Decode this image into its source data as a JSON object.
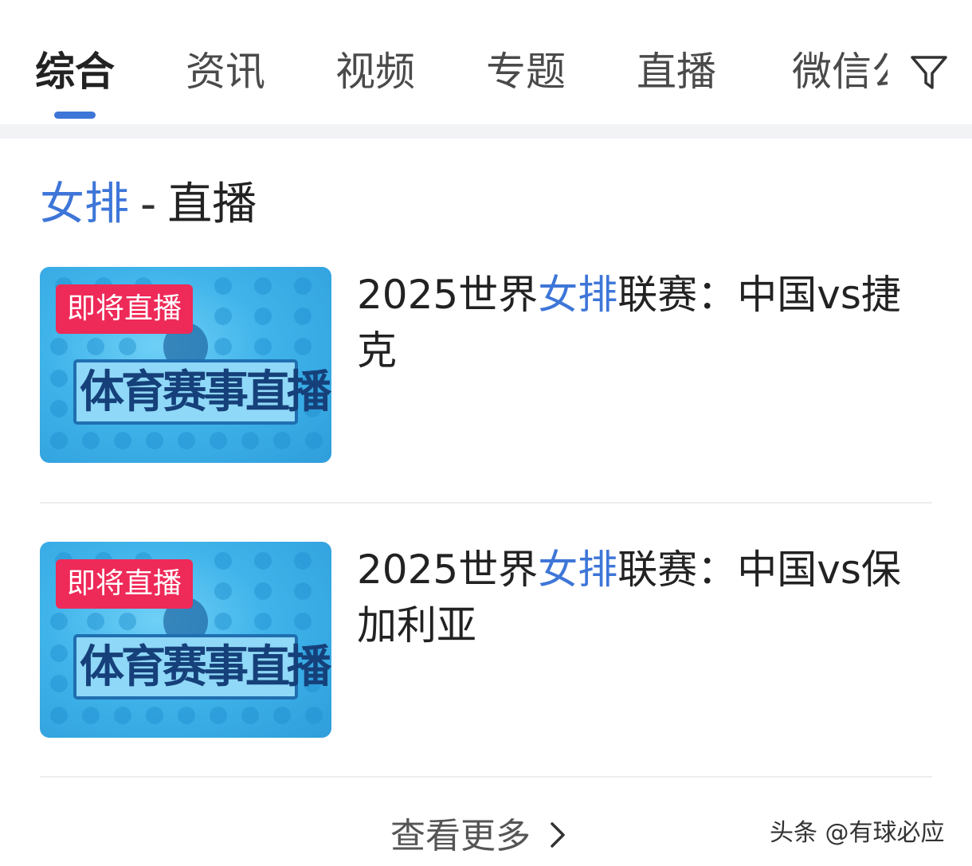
{
  "tabs": [
    {
      "label": "综合"
    },
    {
      "label": "资讯"
    },
    {
      "label": "视频"
    },
    {
      "label": "专题"
    },
    {
      "label": "直播"
    },
    {
      "label": "微信公"
    }
  ],
  "active_tab_index": 0,
  "filter_icon": "filter-icon",
  "colors": {
    "accent": "#3e76d8",
    "badge": "#ee2a58",
    "thumb": "#3fb3ea"
  },
  "section": {
    "keyword": "女排",
    "separator": "-",
    "rest": "直播"
  },
  "items": [
    {
      "badge": "即将直播",
      "banner": "体育赛事直播",
      "title_prefix": "2025世界",
      "title_keyword": "女排",
      "title_suffix": "联赛：中国vs捷克"
    },
    {
      "badge": "即将直播",
      "banner": "体育赛事直播",
      "title_prefix": "2025世界",
      "title_keyword": "女排",
      "title_suffix": "联赛：中国vs保加利亚"
    }
  ],
  "more_label": "查看更多",
  "chevron_icon": "chevron-right-icon",
  "watermark": "头条 @有球必应"
}
